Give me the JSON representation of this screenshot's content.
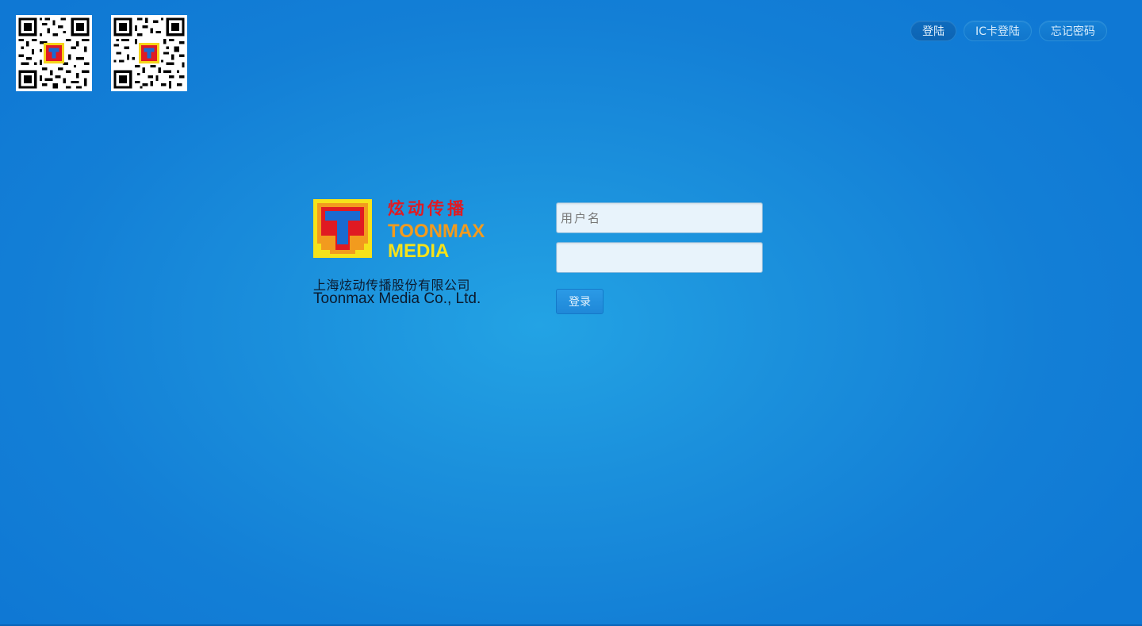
{
  "nav": {
    "login": "登陆",
    "ic_login": "IC卡登陆",
    "forgot_password": "忘记密码"
  },
  "logo": {
    "chinese_name": "炫动传播",
    "english_line1": "TOONMAX",
    "english_line2": "MEDIA",
    "company_cn": "上海炫动传播股份有限公司",
    "company_en": "Toonmax Media Co., Ltd."
  },
  "form": {
    "username_placeholder": "用户名",
    "username_value": "",
    "password_value": "",
    "submit_label": "登录"
  },
  "colors": {
    "background": "#1b90dc",
    "logo_red": "#e01a22",
    "logo_orange": "#f29b1e",
    "logo_yellow": "#f6e21a",
    "field_bg": "#e8f3fb"
  },
  "icons": {
    "qr_1": "qr-code-icon",
    "qr_2": "qr-code-icon",
    "logo": "toonmax-logo-icon"
  }
}
